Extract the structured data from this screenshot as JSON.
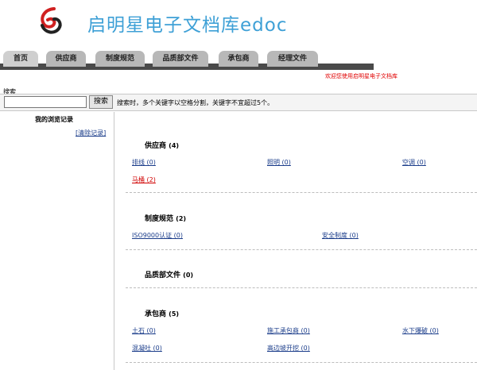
{
  "app": {
    "title": "启明星电子文档库edoc"
  },
  "tabs": [
    {
      "label": "首页"
    },
    {
      "label": "供应商"
    },
    {
      "label": "制度规范"
    },
    {
      "label": "品质部文件"
    },
    {
      "label": "承包商"
    },
    {
      "label": "经理文件"
    }
  ],
  "welcome_text": "欢迎您使用启明星电子文档库",
  "search": {
    "label": "搜索",
    "value": "",
    "placeholder": "",
    "button": "搜索",
    "hint": "搜索时，多个关键字以空格分割，关键字不宜超过5个。"
  },
  "sidebar": {
    "title": "我的浏览记录",
    "clear_link": "[清除记录]"
  },
  "categories": [
    {
      "title": "供应商",
      "count": "(4)",
      "links": [
        {
          "text": "排线 (0)"
        },
        {
          "text": "照明 (0)"
        },
        {
          "text": "空调 (0)"
        },
        {
          "text": "马桶 (2)"
        }
      ]
    },
    {
      "title": "制度规范",
      "count": "(2)",
      "links": [
        {
          "text": "ISO9000认证 (0)"
        },
        {
          "text": "安全制度 (0)"
        }
      ]
    },
    {
      "title": "品质部文件",
      "count": "(0)",
      "links": []
    },
    {
      "title": "承包商",
      "count": "(5)",
      "links": [
        {
          "text": "土石 (0)"
        },
        {
          "text": "施工承包商 (0)"
        },
        {
          "text": "水下爆破 (0)"
        },
        {
          "text": "混凝吐 (0)"
        },
        {
          "text": "高边坡开挖 (0)"
        }
      ]
    }
  ],
  "colors": {
    "title_blue": "#3ea0d6",
    "link_blue": "#1a3c8a",
    "hot_red": "#d00000",
    "tab_grey": "#b8b8b8"
  }
}
